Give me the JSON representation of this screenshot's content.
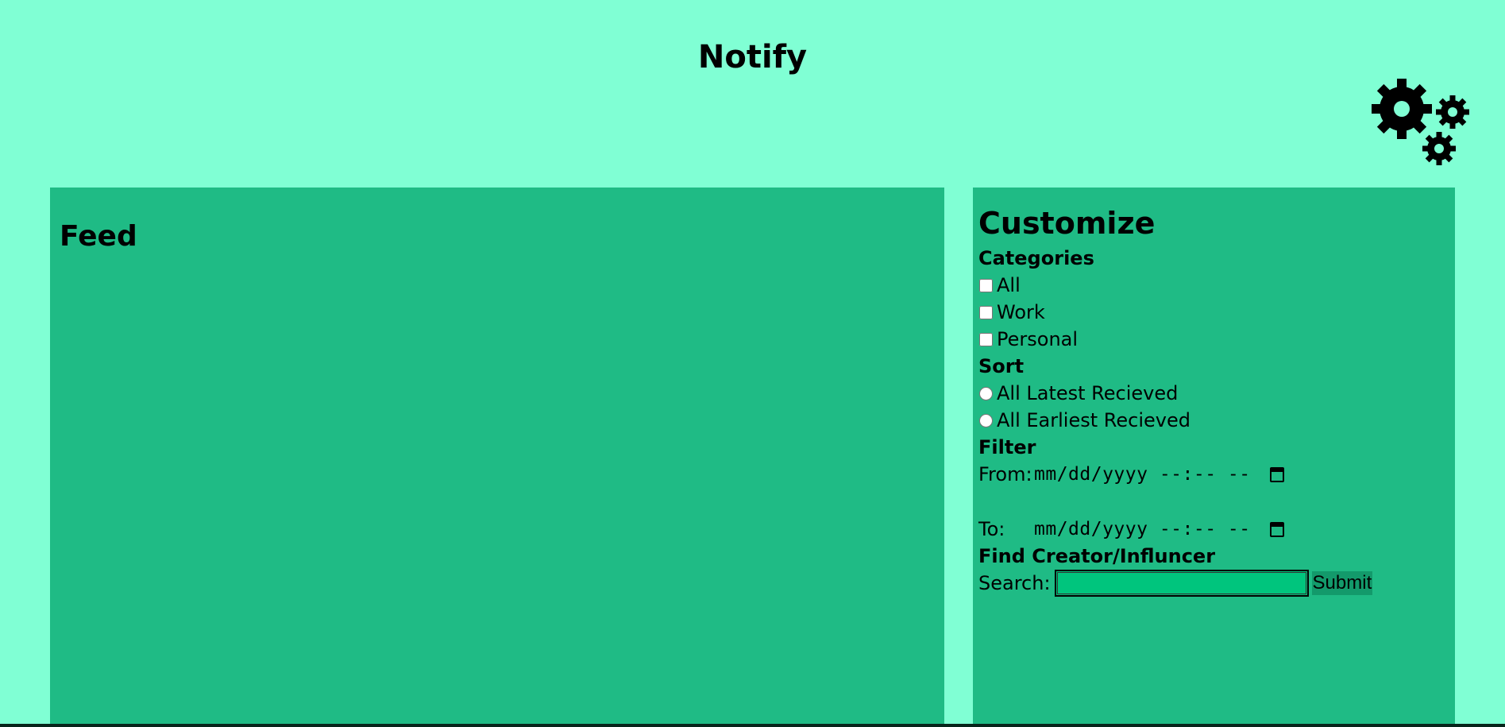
{
  "app": {
    "title": "Notify"
  },
  "icons": {
    "settings": "gears-icon"
  },
  "feed": {
    "title": "Feed"
  },
  "customize": {
    "title": "Customize",
    "categories": {
      "heading": "Categories",
      "options": [
        {
          "label": "All",
          "checked": false
        },
        {
          "label": "Work",
          "checked": false
        },
        {
          "label": "Personal",
          "checked": false
        }
      ]
    },
    "sort": {
      "heading": "Sort",
      "options": [
        {
          "label": "All Latest Recieved",
          "selected": false
        },
        {
          "label": "All Earliest Recieved",
          "selected": false
        }
      ]
    },
    "filter": {
      "heading": "Filter",
      "from_label": "From:",
      "from_value": "mm/dd/yyyy --:-- --",
      "to_label": "To:",
      "to_value": "mm/dd/yyyy --:-- --"
    },
    "find": {
      "heading": "Find Creator/Influncer",
      "search_label": "Search:",
      "search_value": "",
      "submit_label": "Submit"
    }
  },
  "colors": {
    "page_background": "#80ffd4",
    "panel_background": "#1fbb85",
    "search_input_background": "#00c57d",
    "submit_background": "#139a6b"
  }
}
